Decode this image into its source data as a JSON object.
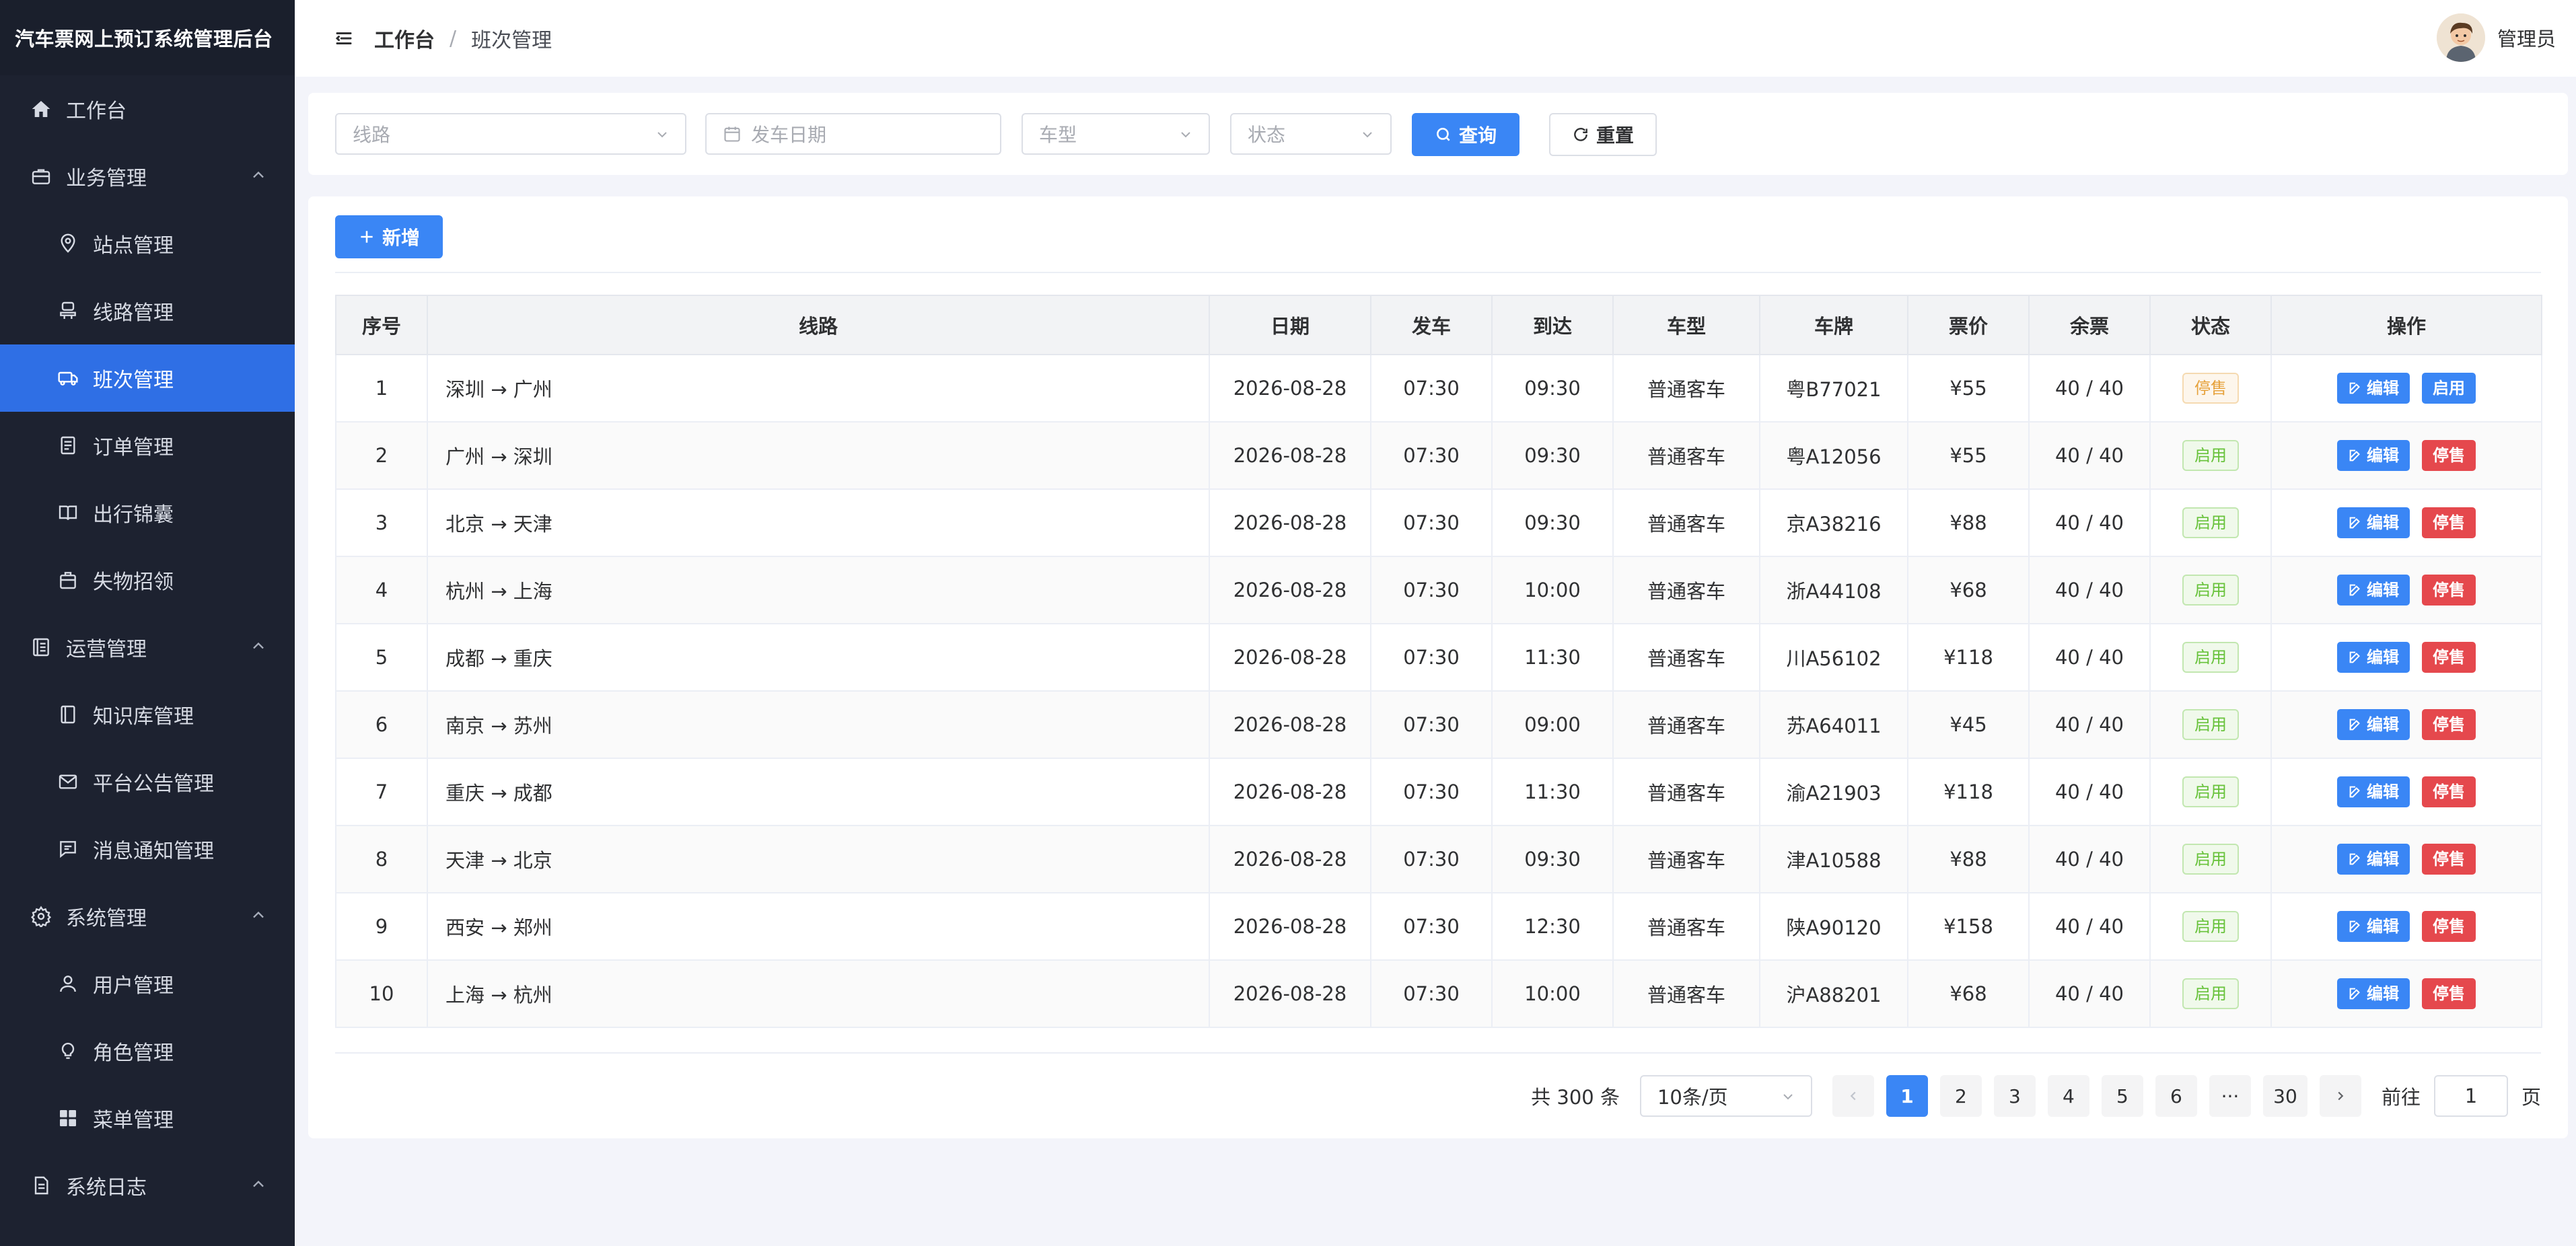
{
  "app": {
    "title": "汽车票网上预订系统管理后台"
  },
  "sidebar": {
    "items": [
      {
        "label": "工作台",
        "level": "top",
        "icon": "home-icon"
      },
      {
        "label": "业务管理",
        "level": "top",
        "icon": "briefcase-icon",
        "expanded": true
      },
      {
        "label": "站点管理",
        "level": "sub",
        "icon": "location-icon"
      },
      {
        "label": "线路管理",
        "level": "sub",
        "icon": "route-icon"
      },
      {
        "label": "班次管理",
        "level": "sub",
        "icon": "bus-icon",
        "active": true
      },
      {
        "label": "订单管理",
        "level": "sub",
        "icon": "document-icon"
      },
      {
        "label": "出行锦囊",
        "level": "sub",
        "icon": "book-icon"
      },
      {
        "label": "失物招领",
        "level": "sub",
        "icon": "bag-icon"
      },
      {
        "label": "运营管理",
        "level": "top",
        "icon": "list-icon",
        "expanded": true
      },
      {
        "label": "知识库管理",
        "level": "sub",
        "icon": "notebook-icon"
      },
      {
        "label": "平台公告管理",
        "level": "sub",
        "icon": "mail-icon"
      },
      {
        "label": "消息通知管理",
        "level": "sub",
        "icon": "chat-icon"
      },
      {
        "label": "系统管理",
        "level": "top",
        "icon": "gear-icon",
        "expanded": true
      },
      {
        "label": "用户管理",
        "level": "sub",
        "icon": "user-icon"
      },
      {
        "label": "角色管理",
        "level": "sub",
        "icon": "bulb-icon"
      },
      {
        "label": "菜单管理",
        "level": "sub",
        "icon": "grid-icon"
      },
      {
        "label": "系统日志",
        "level": "top",
        "icon": "log-icon",
        "expanded": true
      }
    ]
  },
  "header": {
    "breadcrumb": [
      "工作台",
      "班次管理"
    ],
    "breadcrumb_sep": "/",
    "user_name": "管理员"
  },
  "filters": {
    "route_placeholder": "线路",
    "date_placeholder": "发车日期",
    "vehicle_placeholder": "车型",
    "status_placeholder": "状态",
    "query_label": "查询",
    "reset_label": "重置"
  },
  "toolbar": {
    "add_label": "新增"
  },
  "table": {
    "columns": [
      "序号",
      "线路",
      "日期",
      "发车",
      "到达",
      "车型",
      "车牌",
      "票价",
      "余票",
      "状态",
      "操作"
    ],
    "edit_label": "编辑",
    "rows": [
      {
        "no": "1",
        "route": "深圳 → 广州",
        "date": "2026-08-28",
        "depart": "07:30",
        "arrive": "09:30",
        "vehicle": "普通客车",
        "plate": "粤B77021",
        "price": "¥55",
        "remain": "40 / 40",
        "status": "停售",
        "status_type": "warn",
        "action": "启用",
        "action_type": "on"
      },
      {
        "no": "2",
        "route": "广州 → 深圳",
        "date": "2026-08-28",
        "depart": "07:30",
        "arrive": "09:30",
        "vehicle": "普通客车",
        "plate": "粤A12056",
        "price": "¥55",
        "remain": "40 / 40",
        "status": "启用",
        "status_type": "ok",
        "action": "停售",
        "action_type": "off"
      },
      {
        "no": "3",
        "route": "北京 → 天津",
        "date": "2026-08-28",
        "depart": "07:30",
        "arrive": "09:30",
        "vehicle": "普通客车",
        "plate": "京A38216",
        "price": "¥88",
        "remain": "40 / 40",
        "status": "启用",
        "status_type": "ok",
        "action": "停售",
        "action_type": "off"
      },
      {
        "no": "4",
        "route": "杭州 → 上海",
        "date": "2026-08-28",
        "depart": "07:30",
        "arrive": "10:00",
        "vehicle": "普通客车",
        "plate": "浙A44108",
        "price": "¥68",
        "remain": "40 / 40",
        "status": "启用",
        "status_type": "ok",
        "action": "停售",
        "action_type": "off"
      },
      {
        "no": "5",
        "route": "成都 → 重庆",
        "date": "2026-08-28",
        "depart": "07:30",
        "arrive": "11:30",
        "vehicle": "普通客车",
        "plate": "川A56102",
        "price": "¥118",
        "remain": "40 / 40",
        "status": "启用",
        "status_type": "ok",
        "action": "停售",
        "action_type": "off"
      },
      {
        "no": "6",
        "route": "南京 → 苏州",
        "date": "2026-08-28",
        "depart": "07:30",
        "arrive": "09:00",
        "vehicle": "普通客车",
        "plate": "苏A64011",
        "price": "¥45",
        "remain": "40 / 40",
        "status": "启用",
        "status_type": "ok",
        "action": "停售",
        "action_type": "off"
      },
      {
        "no": "7",
        "route": "重庆 → 成都",
        "date": "2026-08-28",
        "depart": "07:30",
        "arrive": "11:30",
        "vehicle": "普通客车",
        "plate": "渝A21903",
        "price": "¥118",
        "remain": "40 / 40",
        "status": "启用",
        "status_type": "ok",
        "action": "停售",
        "action_type": "off"
      },
      {
        "no": "8",
        "route": "天津 → 北京",
        "date": "2026-08-28",
        "depart": "07:30",
        "arrive": "09:30",
        "vehicle": "普通客车",
        "plate": "津A10588",
        "price": "¥88",
        "remain": "40 / 40",
        "status": "启用",
        "status_type": "ok",
        "action": "停售",
        "action_type": "off"
      },
      {
        "no": "9",
        "route": "西安 → 郑州",
        "date": "2026-08-28",
        "depart": "07:30",
        "arrive": "12:30",
        "vehicle": "普通客车",
        "plate": "陕A90120",
        "price": "¥158",
        "remain": "40 / 40",
        "status": "启用",
        "status_type": "ok",
        "action": "停售",
        "action_type": "off"
      },
      {
        "no": "10",
        "route": "上海 → 杭州",
        "date": "2026-08-28",
        "depart": "07:30",
        "arrive": "10:00",
        "vehicle": "普通客车",
        "plate": "沪A88201",
        "price": "¥68",
        "remain": "40 / 40",
        "status": "启用",
        "status_type": "ok",
        "action": "停售",
        "action_type": "off"
      }
    ]
  },
  "pagination": {
    "total_text": "共 300 条",
    "page_size": "10条/页",
    "pages": [
      "1",
      "2",
      "3",
      "4",
      "5",
      "6",
      "···",
      "30"
    ],
    "current": "1",
    "goto_prefix": "前往",
    "goto_value": "1",
    "goto_suffix": "页"
  },
  "colors": {
    "sidebar_bg": "#1d2230",
    "accent": "#3a86f5",
    "danger": "#e5484d",
    "warning": "#e6a23c",
    "success": "#67c23a"
  }
}
